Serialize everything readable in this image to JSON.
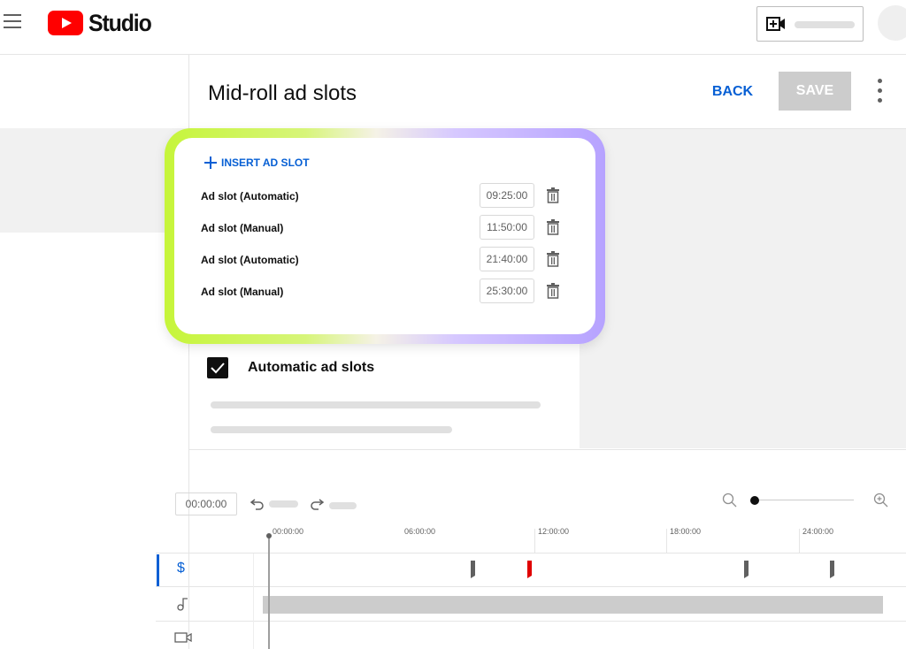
{
  "app": {
    "brand": "Studio"
  },
  "header": {
    "menu_icon": "hamburger-menu-icon",
    "create_icon": "video-plus-icon"
  },
  "page": {
    "title": "Mid-roll ad slots",
    "back_label": "BACK",
    "save_label": "SAVE",
    "more_icon": "more-vertical-icon"
  },
  "ad_slots": {
    "insert_label": "INSERT AD SLOT",
    "items": [
      {
        "label": "Ad slot (Automatic)",
        "time": "09:25:00"
      },
      {
        "label": "Ad slot (Manual)",
        "time": "11:50:00"
      },
      {
        "label": "Ad slot (Automatic)",
        "time": "21:40:00"
      },
      {
        "label": "Ad slot (Manual)",
        "time": "25:30:00"
      }
    ]
  },
  "automatic": {
    "label": "Automatic ad slots",
    "checked": true
  },
  "timeline": {
    "current_time": "00:00:00",
    "ruler": [
      "00:00:00",
      "06:00:00",
      "12:00:00",
      "18:00:00",
      "24:00:00"
    ],
    "tracks": [
      "ads-track",
      "audio-track",
      "video-track"
    ],
    "colors": {
      "accent": "#065fd4",
      "marker": "#606060",
      "selected_marker": "#e00000"
    }
  },
  "colors": {
    "brand_red": "#ff0000",
    "link_blue": "#065fd4",
    "save_disabled": "#cccccc",
    "glow_left": "#c6f53a",
    "glow_right": "#b6a2ff"
  }
}
